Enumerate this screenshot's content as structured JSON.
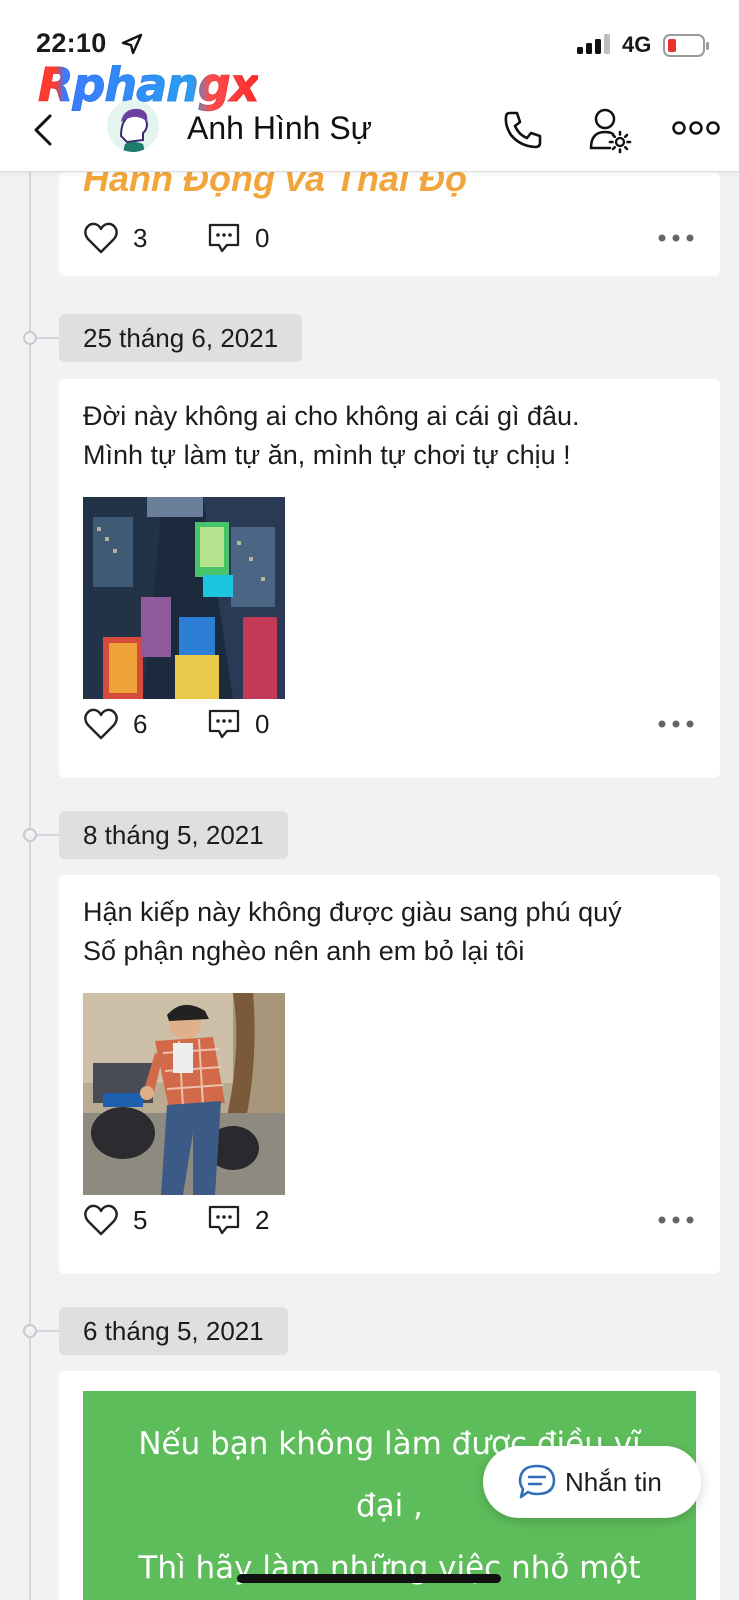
{
  "status_bar": {
    "time": "22:10",
    "network": "4G"
  },
  "brand": {
    "text": "Rphangx"
  },
  "header": {
    "contact_name": "Anh Hình Sự"
  },
  "posts": [
    {
      "partial_title": "Hành Động và Thái Độ",
      "likes": "3",
      "comments": "0"
    },
    {
      "date": "25 tháng 6, 2021",
      "text": "Đời này không ai cho không ai cái gì đâu.\nMình tự làm tự ăn, mình tự chơi tự chịu !",
      "likes": "6",
      "comments": "0"
    },
    {
      "date": "8 tháng 5, 2021",
      "text": "Hận kiếp này không được giàu sang phú quý\nSố phận nghèo nên anh em bỏ lại tôi",
      "likes": "5",
      "comments": "2"
    },
    {
      "date": "6 tháng 5, 2021",
      "green_text": "Nếu bạn không làm được điều vĩ\nđại ,\nThì hãy làm những việc nhỏ một"
    }
  ],
  "chat_fab": {
    "label": "Nhắn tin"
  },
  "colors": {
    "brand_gradient": [
      "#ff3b30",
      "#3a7bff",
      "#ff2d2d"
    ],
    "partial_title": "#f2a53b",
    "green_post_bg": "#5ebd5b",
    "chat_icon": "#2f6fb8"
  }
}
